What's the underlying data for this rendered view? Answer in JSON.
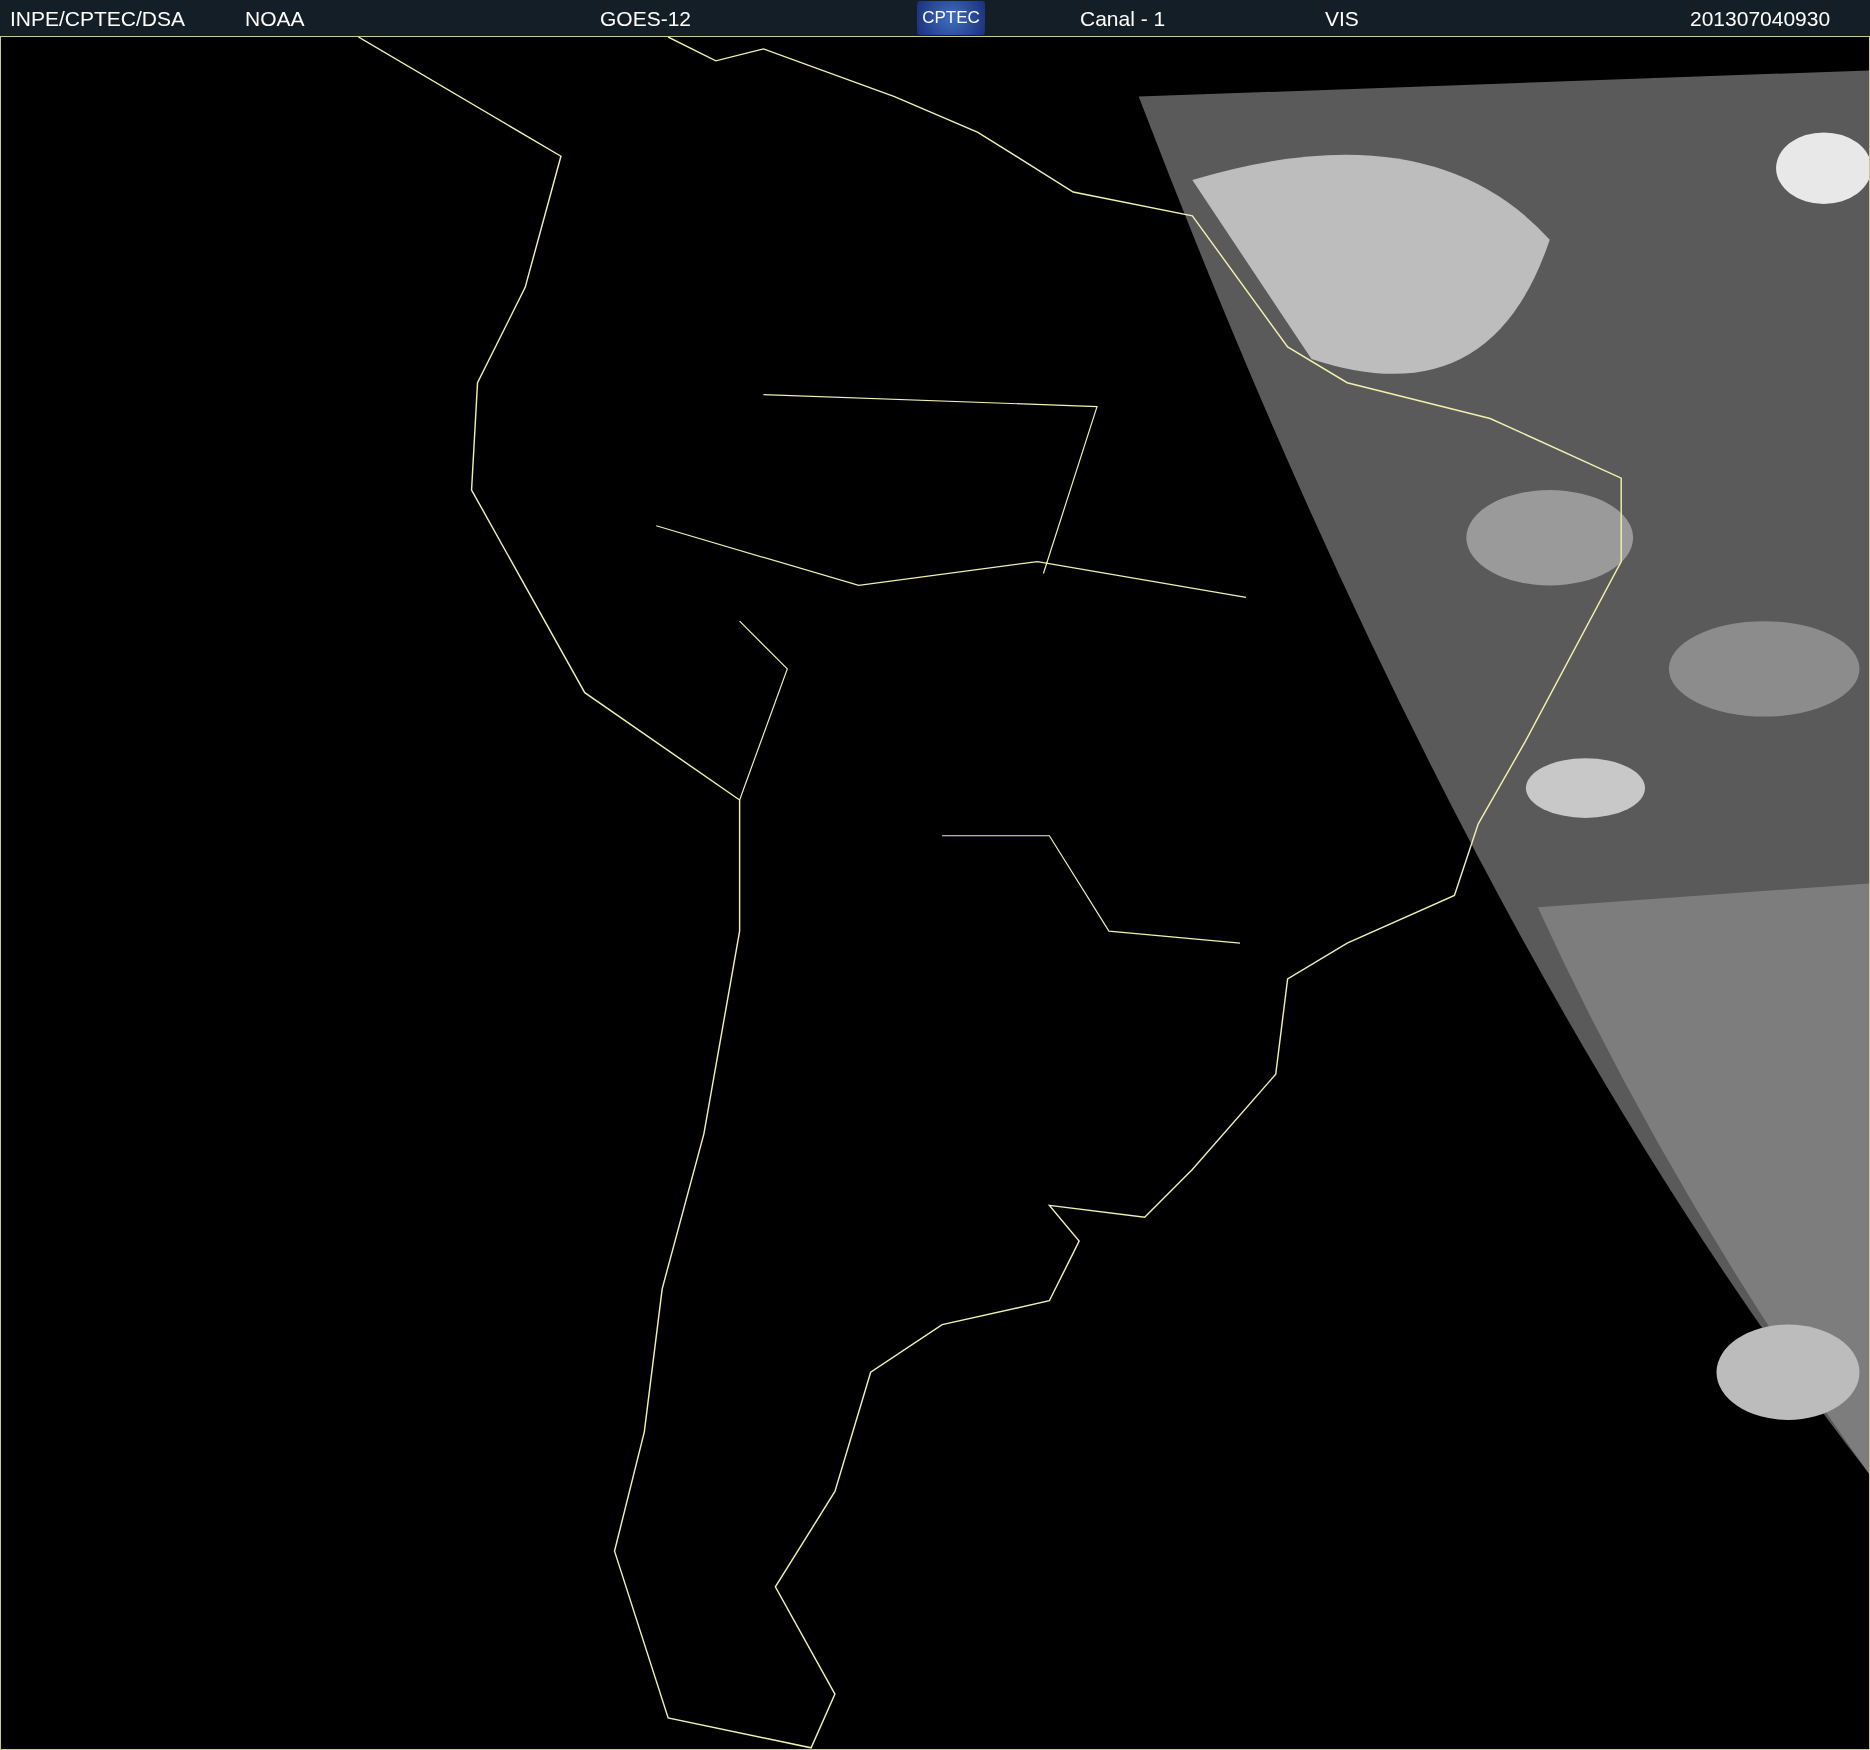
{
  "header": {
    "items": [
      {
        "kind": "text",
        "text": "INPE/CPTEC/DSA"
      },
      {
        "kind": "text",
        "text": "NOAA"
      },
      {
        "kind": "text",
        "text": "GOES-12"
      },
      {
        "kind": "logo",
        "text": "CPTEC"
      },
      {
        "kind": "text",
        "text": "Canal - 1"
      },
      {
        "kind": "text",
        "text": "VIS"
      },
      {
        "kind": "text",
        "text": "201307040930"
      }
    ]
  }
}
